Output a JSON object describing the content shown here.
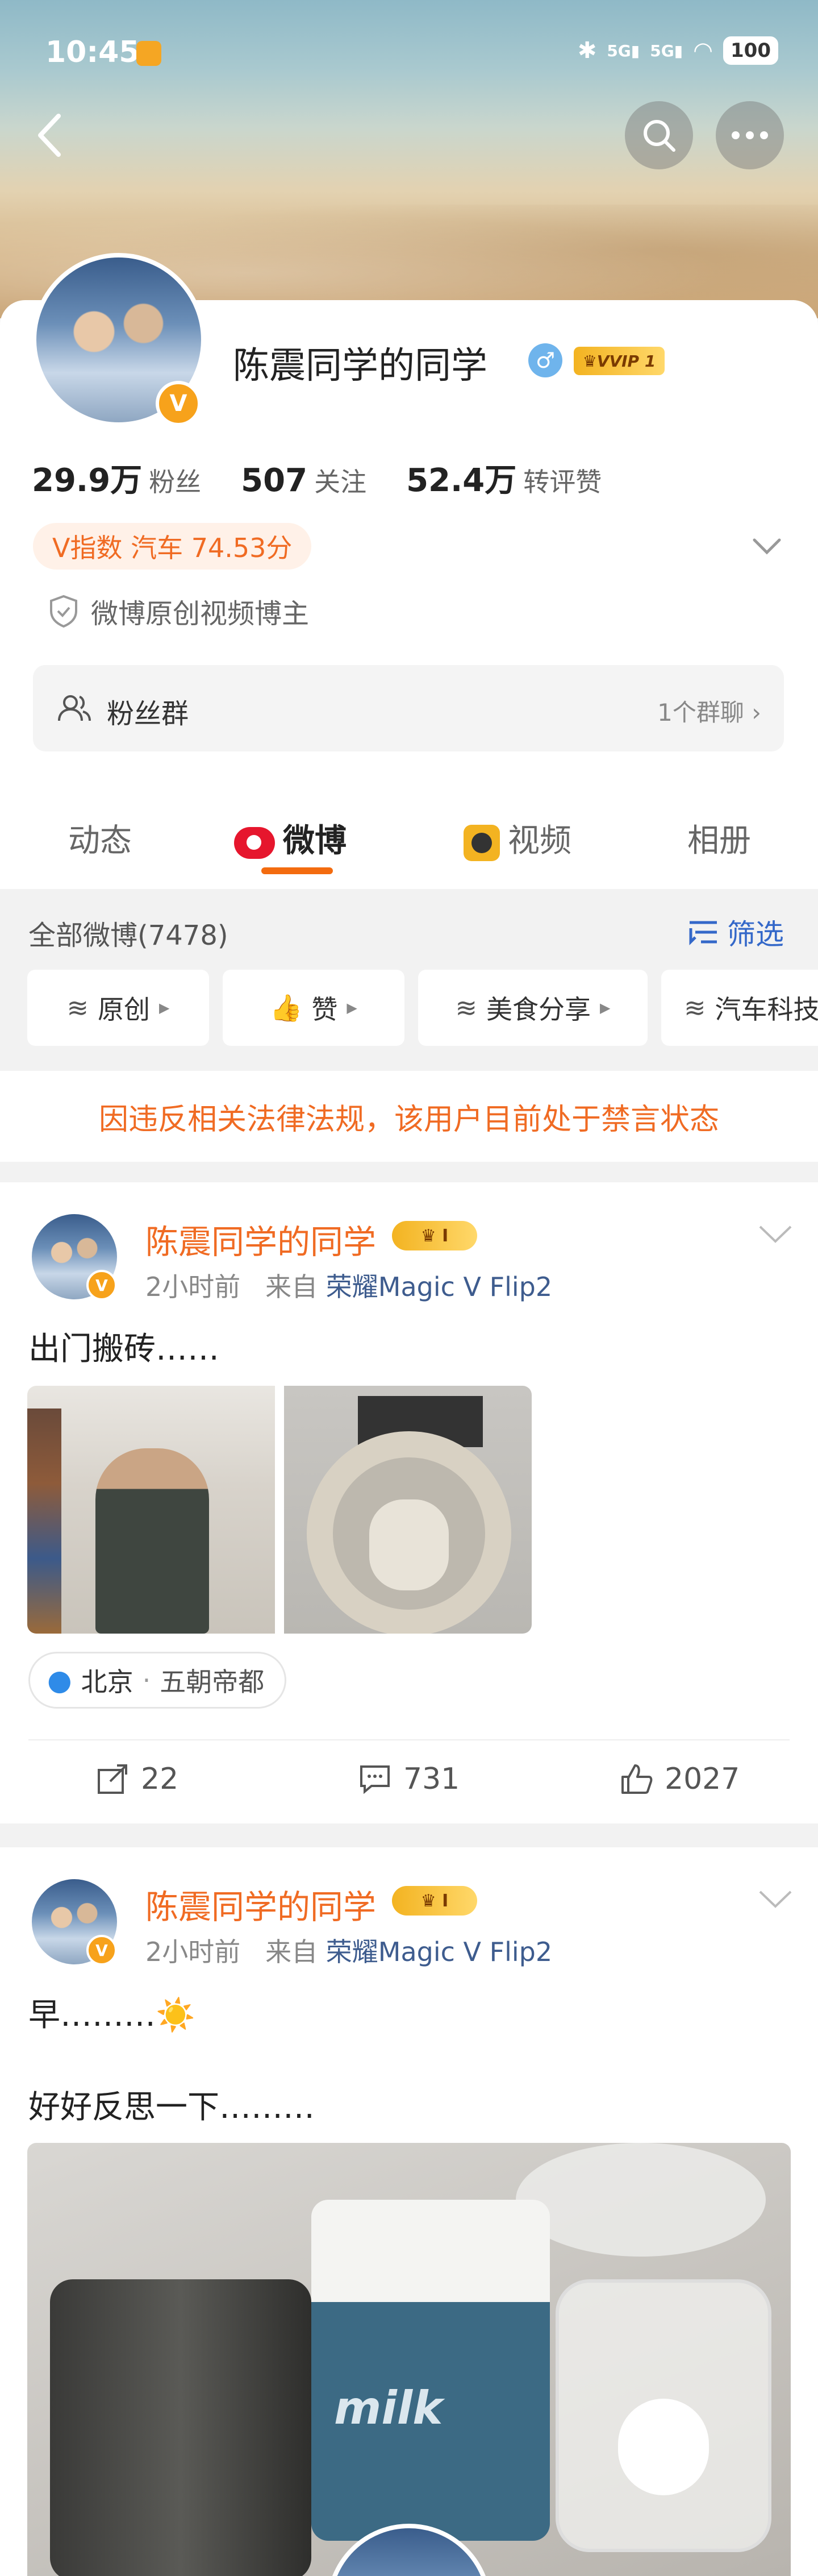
{
  "status_bar": {
    "time": "10:45",
    "network_1": "5G",
    "network_2": "5G",
    "battery": "100"
  },
  "profile": {
    "name": "陈震同学的同学",
    "verified_badge": "V",
    "gender_icon": "male-icon",
    "vip_badge": "VVIP 1",
    "stats": [
      {
        "value": "29.9万",
        "label": "粉丝"
      },
      {
        "value": "507",
        "label": "关注"
      },
      {
        "value": "52.4万",
        "label": "转评赞"
      }
    ],
    "v_index": "V指数 汽车 74.53分",
    "certification": "微博原创视频博主",
    "fan_group": {
      "label": "粉丝群",
      "count": "1个群聊"
    }
  },
  "tabs": [
    {
      "label": "动态",
      "active": false
    },
    {
      "label": "微博",
      "active": true
    },
    {
      "label": "视频",
      "active": false
    },
    {
      "label": "相册",
      "active": false
    }
  ],
  "filter": {
    "all_count": "全部微博(7478)",
    "filter_label": "筛选",
    "chips": [
      "原创",
      "赞",
      "美食分享",
      "汽车科技"
    ]
  },
  "mute_notice": "因违反相关法律法规，该用户目前处于禁言状态",
  "posts": [
    {
      "author": "陈震同学的同学",
      "crown_level": "I",
      "time": "2小时前",
      "from_label": "来自",
      "source": "荣耀Magic V Flip2",
      "text": "出门搬砖……",
      "location_city": "北京",
      "location_name": "五朝帝都",
      "reposts": "22",
      "comments": "731",
      "likes": "2027"
    },
    {
      "author": "陈震同学的同学",
      "crown_level": "I",
      "time": "2小时前",
      "from_label": "来自",
      "source": "荣耀Magic V Flip2",
      "text_line1": "早………☀️",
      "text_line2": "好好反思一下………",
      "image_text": "milk"
    }
  ],
  "colors": {
    "accent_orange": "#f06b23",
    "link_blue": "#3468c9",
    "vip_gold": "#f3b321"
  }
}
